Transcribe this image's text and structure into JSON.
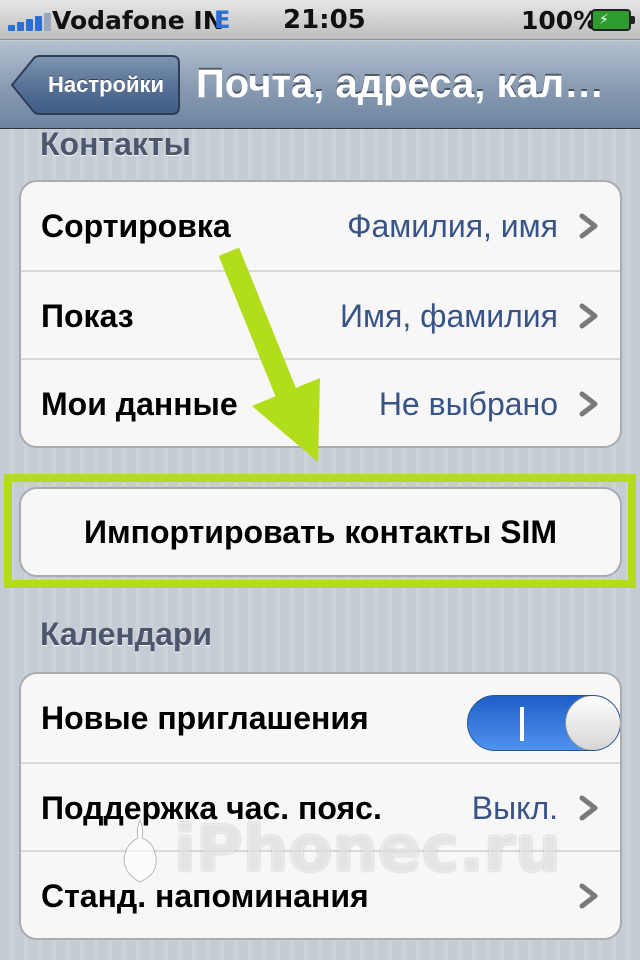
{
  "status_bar": {
    "carrier": "Vodafone IN",
    "network": "E",
    "time": "21:05",
    "battery": "100%",
    "signal_icon": "signal-bars-icon",
    "battery_icon": "battery-charging-icon"
  },
  "nav": {
    "back_label": "Настройки",
    "title": "Почта, адреса, кал…"
  },
  "contacts": {
    "header": "Контакты",
    "rows": [
      {
        "label": "Сортировка",
        "value": "Фамилия, имя"
      },
      {
        "label": "Показ",
        "value": "Имя, фамилия"
      },
      {
        "label": "Мои данные",
        "value": "Не выбрано"
      }
    ],
    "import_label": "Импортировать контакты SIM"
  },
  "calendars": {
    "header": "Календари",
    "rows": [
      {
        "label": "Новые приглашения",
        "toggle_on": true
      },
      {
        "label": "Поддержка час. пояс.",
        "value": "Выкл."
      },
      {
        "label": "Станд. напоминания",
        "value": ""
      }
    ]
  },
  "watermark": {
    "text": "iPhonec.ru"
  },
  "colors": {
    "highlight": "#b2dd1b",
    "value_text": "#385487",
    "toggle_on": "#2b6fd6"
  }
}
